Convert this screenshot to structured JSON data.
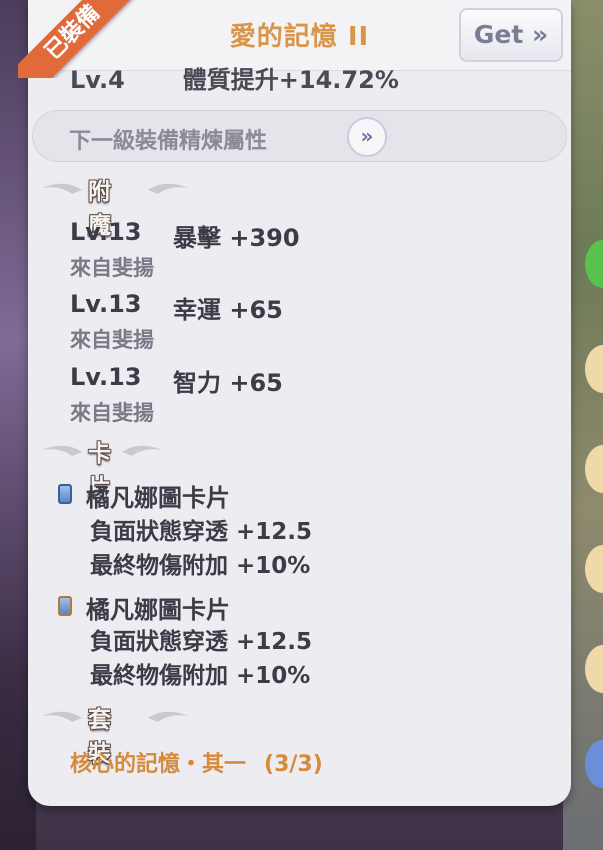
{
  "header": {
    "title": "愛的記憶 II",
    "get_label": "Get",
    "get_arrow": "»",
    "ribbon_label": "已裝備"
  },
  "refine": {
    "partial_level": "Lv.4",
    "partial_stat": "體質提升+14.72%",
    "next_label": "下一級裝備精煉屬性",
    "next_arrow": "»"
  },
  "enchant": {
    "title": "附魔",
    "rows": [
      {
        "level": "Lv.13",
        "stat": "暴擊 +390",
        "source": "來自斐揚"
      },
      {
        "level": "Lv.13",
        "stat": "幸運 +65",
        "source": "來自斐揚"
      },
      {
        "level": "Lv.13",
        "stat": "智力 +65",
        "source": "來自斐揚"
      }
    ]
  },
  "cards": {
    "title": "卡片",
    "items": [
      {
        "name": "橘凡娜圖卡片",
        "effect1": "負面狀態穿透 +12.5",
        "effect2": "最終物傷附加 +10%"
      },
      {
        "name": "橘凡娜圖卡片",
        "effect1": "負面狀態穿透 +12.5",
        "effect2": "最終物傷附加 +10%"
      }
    ]
  },
  "set": {
    "title": "套裝",
    "name": "核心的記憶・其一",
    "count": "(3/3)"
  },
  "colors": {
    "title_orange": "#d9954a",
    "set_orange": "#d68a3c",
    "ribbon": "#e06a3a",
    "panel_bg": "#ececf1"
  }
}
